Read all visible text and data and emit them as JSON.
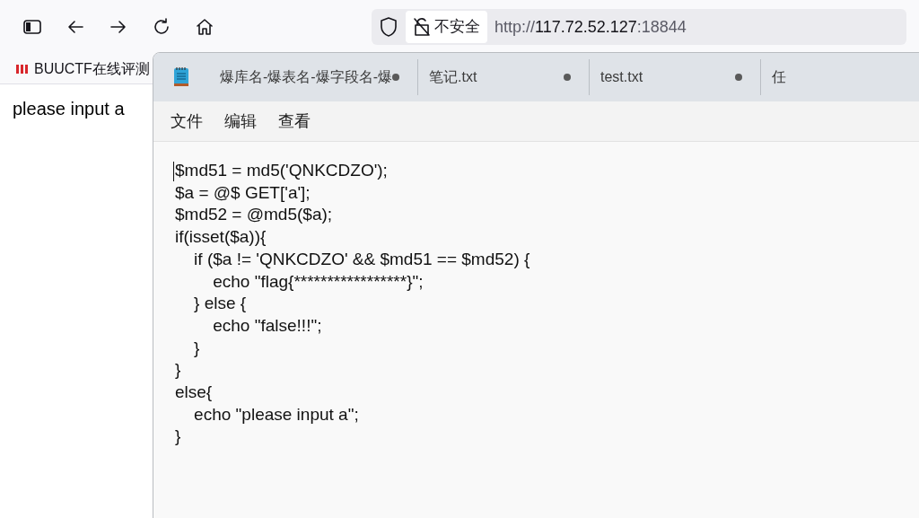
{
  "browser": {
    "address": {
      "security_label": "不安全",
      "url_scheme": "http://",
      "url_host": "117.72.52.127",
      "url_port": ":18844"
    },
    "bookmarks": [
      {
        "label": "BUUCTF在线评测"
      }
    ],
    "page": {
      "text": "please input a"
    }
  },
  "notepad": {
    "tabs": [
      {
        "label": "爆库名-爆表名-爆字段名-爆",
        "modified": true,
        "selected": false
      },
      {
        "label": "笔记.txt",
        "modified": true,
        "selected": false
      },
      {
        "label": "test.txt",
        "modified": true,
        "selected": false
      },
      {
        "label": "任",
        "modified": false,
        "selected": false
      }
    ],
    "menu": [
      "文件",
      "编辑",
      "查看"
    ],
    "lines": [
      "$md51 = md5('QNKCDZO');",
      "$a = @$ GET['a'];",
      "$md52 = @md5($a);",
      "if(isset($a)){",
      "    if ($a != 'QNKCDZO' && $md51 == $md52) {",
      "        echo \"flag{*****************}\";",
      "    } else {",
      "        echo \"false!!!\";",
      "    }",
      "}",
      "else{",
      "    echo \"please input a\";",
      "}"
    ]
  }
}
